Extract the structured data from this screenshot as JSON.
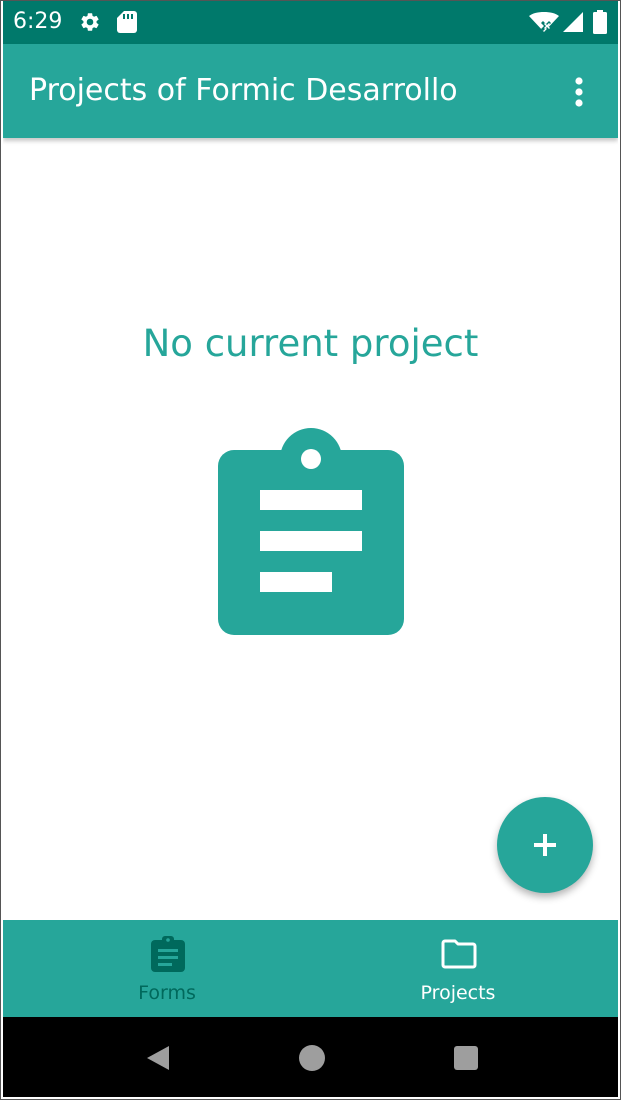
{
  "status_bar": {
    "time": "6:29",
    "icons": [
      "gear-icon",
      "sd-card-icon",
      "wifi-no-internet-icon",
      "cell-signal-icon",
      "battery-icon"
    ],
    "background": "#00796b"
  },
  "app_bar": {
    "title": "Projects of Formic Desarrollo",
    "menu_icon": "more-vert-icon",
    "background": "#26a69a"
  },
  "empty_state": {
    "message": "No current project",
    "icon": "clipboard-icon",
    "color": "#26a69a"
  },
  "fab": {
    "icon": "plus-icon",
    "color": "#26a69a"
  },
  "bottom_nav": {
    "background": "#26a69a",
    "items": [
      {
        "label": "Forms",
        "icon": "assignment-icon",
        "active": false,
        "color": "#00695c"
      },
      {
        "label": "Projects",
        "icon": "folder-icon",
        "active": true,
        "color": "#ffffff"
      }
    ]
  },
  "system_nav": {
    "buttons": [
      "back-icon",
      "home-icon",
      "recents-icon"
    ]
  }
}
